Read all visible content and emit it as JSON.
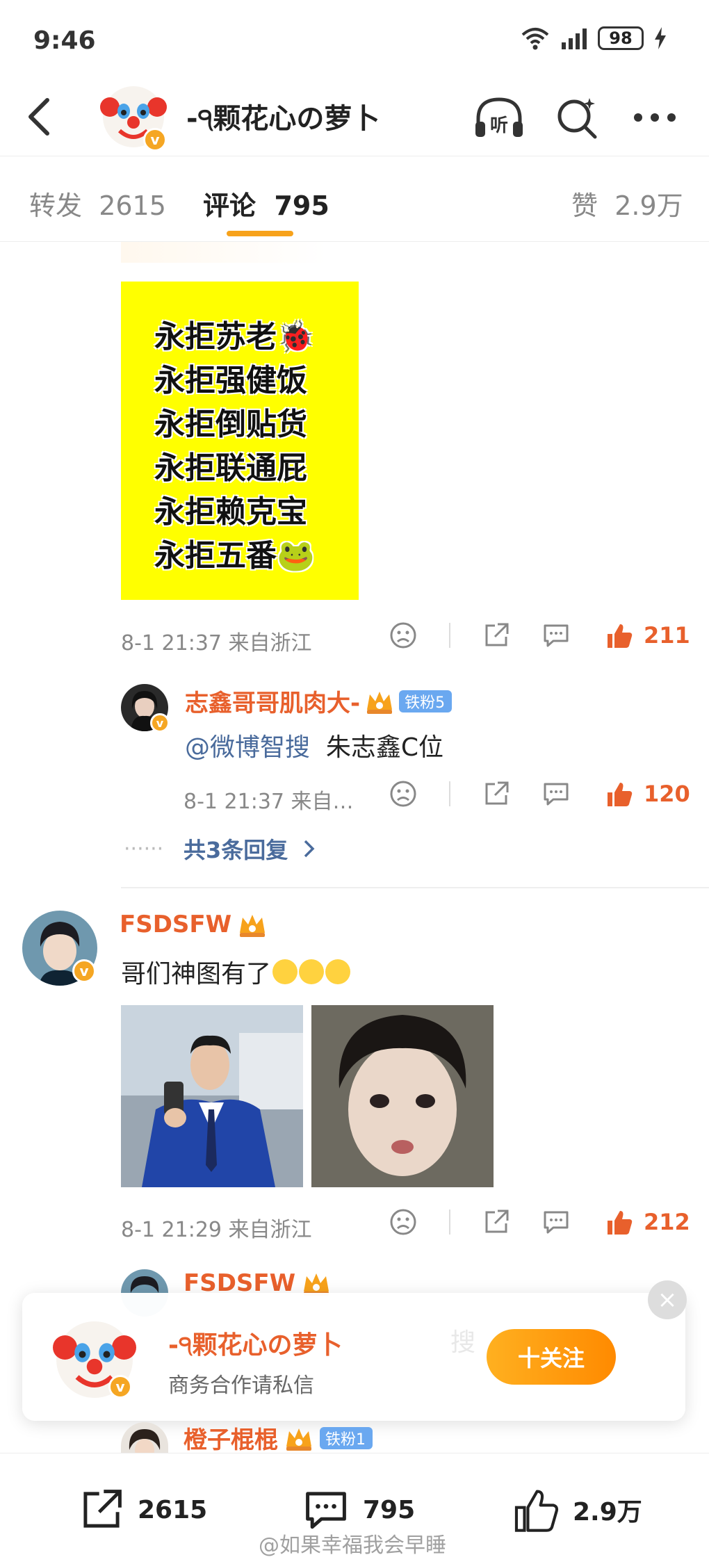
{
  "status_bar": {
    "time": "9:46",
    "battery": "98"
  },
  "header": {
    "username": "-੧颗花心の萝卜",
    "listen_label": "听"
  },
  "tabs": [
    {
      "label": "转发",
      "count": "2615"
    },
    {
      "label": "评论",
      "count": "795"
    },
    {
      "label": "赞",
      "count": "2.9万"
    }
  ],
  "poster": {
    "lines": [
      "永拒苏老🐞",
      "永拒强健饭",
      "永拒倒贴货",
      "永拒联通屁",
      "永拒赖克宝",
      "永拒五番🐸"
    ]
  },
  "comment1_actions": {
    "meta": "8-1 21:37 来自浙江",
    "likes": "211"
  },
  "reply1": {
    "username": "志鑫哥哥肌肉大-",
    "fan_badge": "铁粉5",
    "mention": "@微博智搜",
    "text": "朱志鑫C位",
    "meta": "8-1 21:37 来自…",
    "likes": "120"
  },
  "replies_link": "共3条回复",
  "comment2": {
    "username": "FSDSFW",
    "text": "哥们神图有了",
    "meta": "8-1 21:29 来自浙江",
    "likes": "212"
  },
  "reply2": {
    "username": "FSDSFW",
    "text_partial": "搜"
  },
  "reply3": {
    "username": "橙子棍棍",
    "fan_badge": "铁粉1"
  },
  "follow_card": {
    "name": "-੧颗花心の萝卜",
    "subtitle": "商务合作请私信",
    "button": "十关注",
    "close": "×"
  },
  "bottom_bar": {
    "reposts": "2615",
    "comments": "795",
    "likes": "2.9万"
  },
  "watermark": "@如果幸福我会早睡",
  "colors": {
    "accent": "#f7a21b",
    "like": "#e8602c",
    "mention": "#4a6b9c",
    "fan_badge": "#6aa8f0"
  }
}
